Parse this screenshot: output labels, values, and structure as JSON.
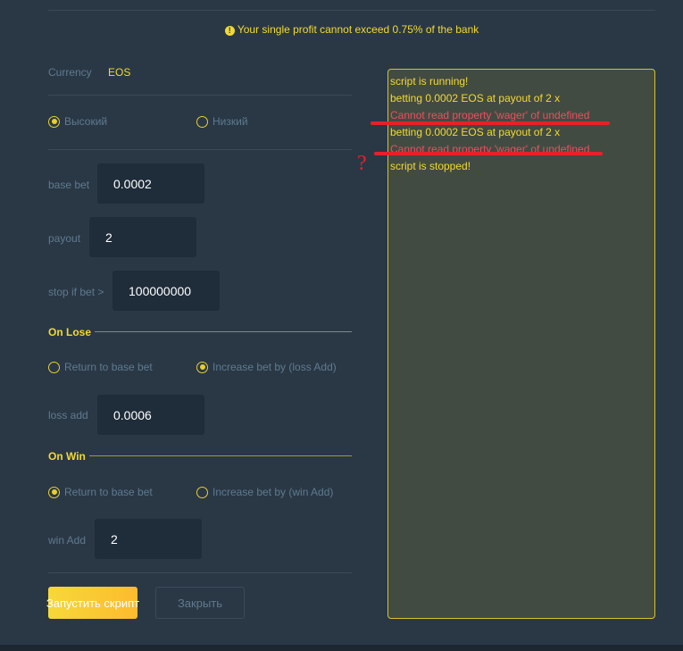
{
  "notice": {
    "icon": "exclamation-circle-icon",
    "text": "Your single profit cannot exceed 0.75% of the bank"
  },
  "currency": {
    "label": "Currency",
    "value": "EOS"
  },
  "mode": {
    "options": [
      "Высокий",
      "Низкий"
    ],
    "selected": 0
  },
  "fields": {
    "base_bet": {
      "label": "base bet",
      "value": "0.0002"
    },
    "payout": {
      "label": "payout",
      "value": "2"
    },
    "stop_if_bet": {
      "label": "stop if bet >",
      "value": "100000000"
    },
    "loss_add": {
      "label": "loss add",
      "value": "0.0006"
    },
    "win_add": {
      "label": "win Add",
      "value": "2"
    }
  },
  "on_lose": {
    "title": "On Lose",
    "options": [
      "Return to base bet",
      "Increase bet by (loss Add)"
    ],
    "selected": 1
  },
  "on_win": {
    "title": "On Win",
    "options": [
      "Return to base bet",
      "Increase bet by (win Add)"
    ],
    "selected": 0
  },
  "buttons": {
    "run": "Запустить скрипт",
    "close": "Закрыть"
  },
  "log": [
    {
      "text": "script is running!",
      "type": "info"
    },
    {
      "text": "betting 0.0002 EOS at payout of 2 x",
      "type": "info"
    },
    {
      "text": "Cannot read property 'wager' of undefined",
      "type": "error"
    },
    {
      "text": "betting 0.0002 EOS at payout of 2 x",
      "type": "info"
    },
    {
      "text": "Cannot read property 'wager' of undefined",
      "type": "error"
    },
    {
      "text": "script is stopped!",
      "type": "info"
    }
  ],
  "annotation": {
    "mark": "?"
  },
  "colors": {
    "accent": "#f2d930",
    "error": "#ee4d5e",
    "background": "#2a3846",
    "input": "#1f2c3a",
    "log_bg": "#424b42",
    "annotation": "#e8202a"
  }
}
